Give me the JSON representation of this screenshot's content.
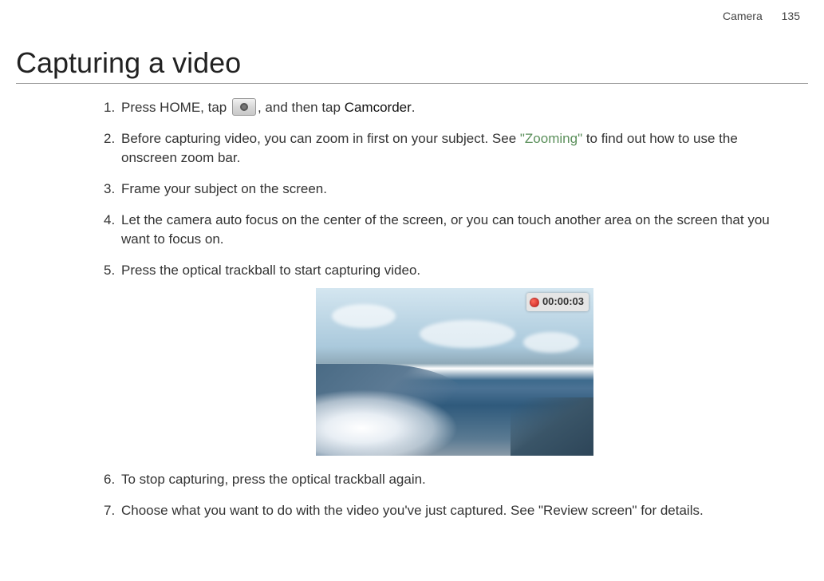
{
  "header": {
    "section": "Camera",
    "page_number": "135"
  },
  "title": "Capturing a video",
  "steps": {
    "s1_a": "Press HOME, tap ",
    "s1_b": ", and then tap ",
    "s1_bold": "Camcorder",
    "s1_c": ".",
    "s2_a": "Before capturing video, you can zoom in first on your subject. See ",
    "s2_link": "\"Zooming\"",
    "s2_b": " to find out how to use the onscreen zoom bar.",
    "s3": "Frame your subject on the screen.",
    "s4": "Let the camera auto focus on the center of the screen, or you can touch another area on the screen that you want to focus on.",
    "s5": "Press the optical trackball to start capturing video.",
    "s6": "To stop capturing, press the optical trackball again.",
    "s7": "Choose what you want to do with the video you've just captured. See \"Review screen\" for details."
  },
  "screenshot": {
    "timer": "00:00:03"
  }
}
